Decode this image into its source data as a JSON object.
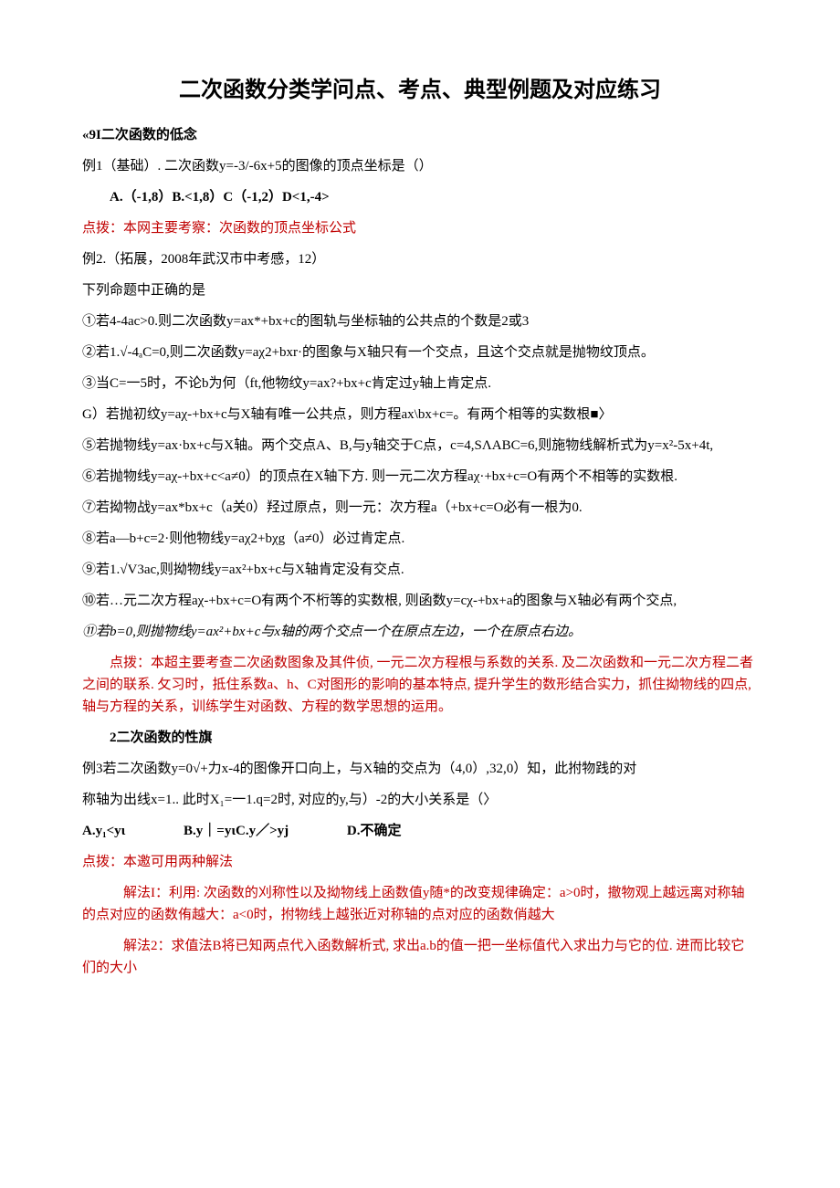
{
  "title": "二次函数分类学问点、考点、典型例题及对应练习",
  "s1_heading": "«9I二次函数的低念",
  "ex1_intro": "例1（基础）. 二次函数y=-3/-6x+5的图像的顶点坐标是（）",
  "ex1_opts": "A.（-1,8）B.<1,8）C（-1,2）D<1,-4>",
  "ex1_hint": "点拨：本网主要考察：次函数的顶点坐标公式",
  "ex2_intro1": "例2.（拓展，2008年武汉市中考感，12）",
  "ex2_intro2": "下列命题中正确的是",
  "p1": "①若4-4ac>0.则二次函数y=ax*+bx+c的图轨与坐标轴的公共点的个数是2或3",
  "p2": "②若1.√-4ₐC=0,则二次函数y=aχ2+bxr·的图象与X轴只有一个交点，且这个交点就是抛物纹顶点。",
  "p3": "③当C=一5时，不论b为何（ft,他物纹y=ax?+bx+c肯定过y轴上肯定点.",
  "p4": "G）若抛初纹y=aχ-+bx+c与X轴有唯一公共点，则方程ax\\bx+c=。有两个相等的实数根■〉",
  "p5": "⑤若抛物线y=ax·bx+c与X轴。两个交点A、B,与y轴交于C点，c=4,SΛABC=6,则施物线解析式为y=x²-5x+4t,",
  "p6": "⑥若抛物线y=aχ-+bx+c<a≠0）的顶点在X轴下方. 则一元二次方程aχ·+bx+c=O有两个不相等的实数根.",
  "p7": "⑦若拗物战y=ax*bx+c（a关0）羟过原点，则一元：次方程a（+bx+c=O必有一根为0.",
  "p8": "⑧若a—b+c=2·则他物线y=aχ2+bχg（a≠0）必过肯定点.",
  "p9": "⑨若1.√V3ac,则拗物线y=ax²+bx+c与X轴肯定没有交点.",
  "p10": "⑩若…元二次方程aχ-+bx+c=O有两个不桁等的实数根, 则函数y=cχ-+bx+a的图象与X轴必有两个交点,",
  "p11": "⑪若b=0,则抛物线y=ax²+bx+c与x轴的两个交点一个在原点左边，一个在原点右边。",
  "hint2": "点拨：本超主要考查二次函数图象及其件侦, 一元二次方程根与系数的关系. 及二次函数和一元二次方程二者之间的联系. 攵习时，抵住系数a、h、C对图形的影响的基本特点, 提升学生的数形结合实力，抓住拗物线的四点, 轴与方程的关系，训练学生对函数、方程的数学思想的运用。",
  "s2_heading": "2二次函数的性旗",
  "ex3_line1": "例3若二次函数y=0√+力x-4的图像开口向上，与X轴的交点为（4,0）,32,0）知，此拊物践的对",
  "ex3_line2": "称轴为出线x=1.. 此时X₁=一1.q=2时, 对应的y,与）-2的大小关系是（〉",
  "ex3_optA": "A.y₁<yι",
  "ex3_optB": "B.y｜=yιC.y／>yj",
  "ex3_optD": "D.不确定",
  "hint3_head": "点拨：本邀可用两种解法",
  "hint3_m1": "解法I：利用: 次函数的刈称性以及拗物线上函数值y随*的改变规律确定：a>0时，撤物观上越远离对称轴的点对应的函数侑越大：a<0时，拊物线上越张近对称轴的点对应的函数俏越大",
  "hint3_m2": "解法2：求值法B将已知两点代入函数解析式, 求出a.b的值一把一坐标值代入求出力与它的位. 进而比较它们的大小"
}
